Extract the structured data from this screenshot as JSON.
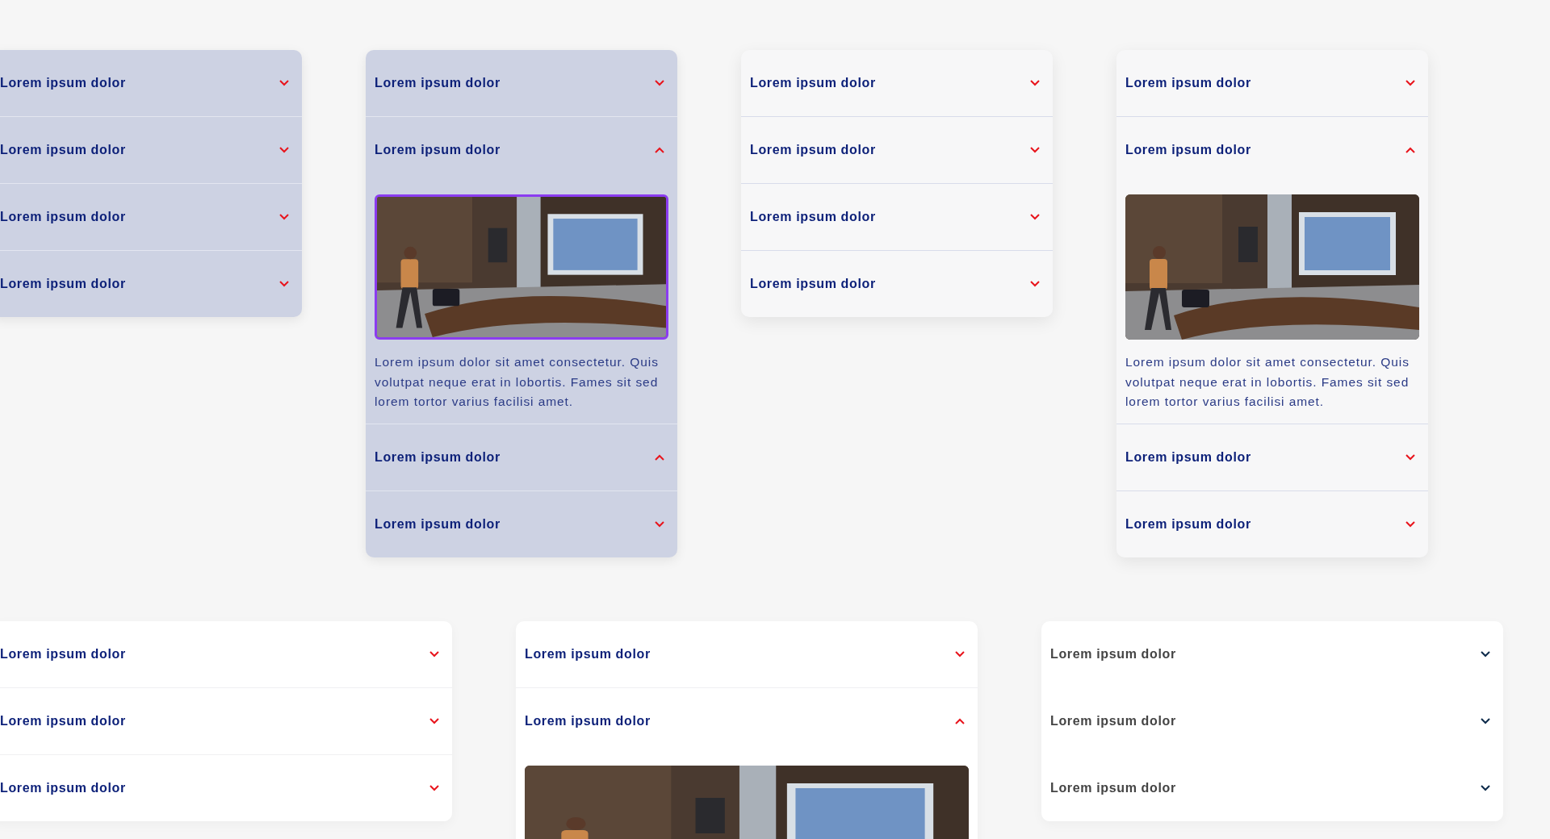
{
  "rows": [
    {
      "cards": [
        {
          "kind": "filled",
          "items": [
            {
              "title": "Lorem ipsum dolor",
              "arrow_up": false
            },
            {
              "title": "Lorem ipsum dolor",
              "arrow_up": false
            },
            {
              "title": "Lorem ipsum dolor",
              "arrow_up": false
            },
            {
              "title": "Lorem ipsum dolor",
              "arrow_up": false
            }
          ]
        },
        {
          "kind": "filled",
          "items": [
            {
              "title": "Lorem ipsum dolor",
              "arrow_up": false
            },
            {
              "title": "Lorem ipsum dolor",
              "arrow_up": true,
              "image": {
                "kind": "picture",
                "focused": true
              },
              "body": "Lorem ipsum dolor sit amet consectetur. Quis volutpat neque erat in lobortis. Fames sit sed lorem tortor varius facilisi amet."
            },
            {
              "title": "Lorem ipsum dolor",
              "arrow_up": true
            },
            {
              "title": "Lorem ipsum dolor",
              "arrow_up": false
            }
          ]
        },
        {
          "kind": "light",
          "items": [
            {
              "title": "Lorem ipsum dolor",
              "arrow_up": false
            },
            {
              "title": "Lorem ipsum dolor",
              "arrow_up": false
            },
            {
              "title": "Lorem ipsum dolor",
              "arrow_up": false
            },
            {
              "title": "Lorem ipsum dolor",
              "arrow_up": false
            }
          ]
        },
        {
          "kind": "light",
          "items": [
            {
              "title": "Lorem ipsum dolor",
              "arrow_up": false
            },
            {
              "title": "Lorem ipsum dolor",
              "arrow_up": true,
              "image": {
                "kind": "picture",
                "focused": false
              },
              "body": "Lorem ipsum dolor sit amet consectetur. Quis volutpat neque erat in lobortis. Fames sit sed lorem tortor varius facilisi amet."
            },
            {
              "title": "Lorem ipsum dolor",
              "arrow_up": false
            },
            {
              "title": "Lorem ipsum dolor",
              "arrow_up": false
            }
          ]
        }
      ]
    },
    {
      "cards": [
        {
          "kind": "white",
          "items": [
            {
              "title": "Lorem ipsum dolor",
              "arrow_up": false
            },
            {
              "title": "Lorem ipsum dolor",
              "arrow_up": false
            },
            {
              "title": "Lorem ipsum dolor",
              "arrow_up": false
            }
          ]
        },
        {
          "kind": "white",
          "items": [
            {
              "title": "Lorem ipsum dolor",
              "arrow_up": false
            },
            {
              "title": "Lorem ipsum dolor",
              "arrow_up": true,
              "image": {
                "kind": "picture",
                "focused": false
              }
            }
          ]
        },
        {
          "kind": "plain",
          "items": [
            {
              "title": "Lorem ipsum dolor",
              "arrow_up": false
            },
            {
              "title": "Lorem ipsum dolor",
              "arrow_up": false
            },
            {
              "title": "Lorem ipsum dolor",
              "arrow_up": false
            }
          ]
        }
      ]
    }
  ]
}
